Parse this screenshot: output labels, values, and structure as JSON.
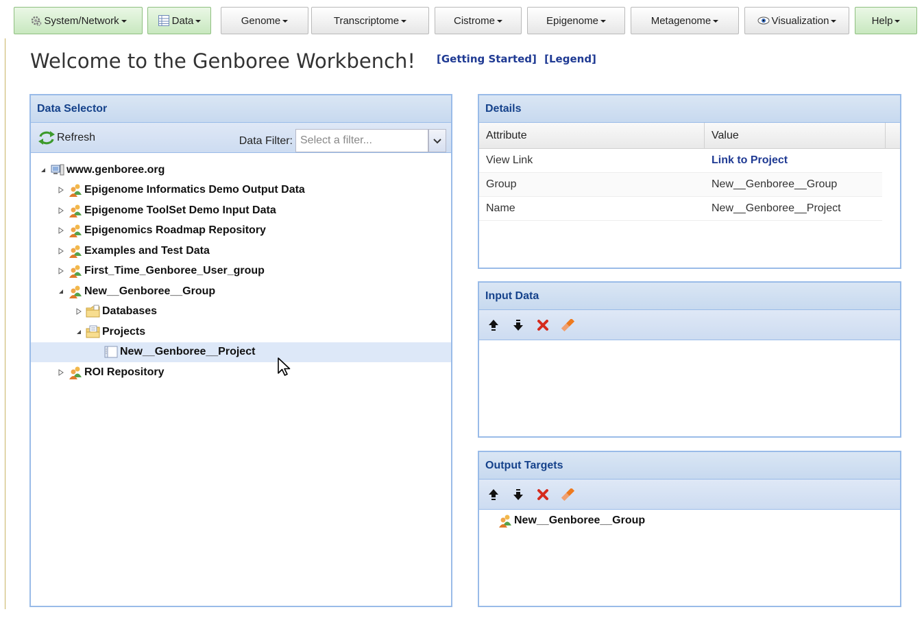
{
  "toolbar": {
    "system_network": "System/Network",
    "data": "Data",
    "genome": "Genome",
    "transcriptome": "Transcriptome",
    "cistrome": "Cistrome",
    "epigenome": "Epigenome",
    "metagenome": "Metagenome",
    "visualization": "Visualization",
    "help": "Help"
  },
  "header": {
    "title": "Welcome to the Genboree Workbench!",
    "getting_started": "[Getting Started]",
    "legend": "[Legend]"
  },
  "data_selector": {
    "title": "Data Selector",
    "refresh_label": "Refresh",
    "filter_label": "Data Filter:",
    "filter_placeholder": "Select a filter...",
    "tree": {
      "root": "www.genboree.org",
      "groups": [
        "Epigenome Informatics Demo Output Data",
        "Epigenome ToolSet Demo Input Data",
        "Epigenomics Roadmap Repository",
        "Examples and Test Data",
        "First_Time_Genboree_User_group",
        "New__Genboree__Group"
      ],
      "databases": "Databases",
      "projects": "Projects",
      "project": "New__Genboree__Project",
      "roi": "ROI Repository"
    }
  },
  "details": {
    "title": "Details",
    "col_attribute": "Attribute",
    "col_value": "Value",
    "rows": [
      {
        "attr": "View Link",
        "value": "Link to Project"
      },
      {
        "attr": "Group",
        "value": "New__Genboree__Group"
      },
      {
        "attr": "Name",
        "value": "New__Genboree__Project"
      }
    ]
  },
  "input_data": {
    "title": "Input Data"
  },
  "output_targets": {
    "title": "Output Targets",
    "items": [
      "New__Genboree__Group"
    ]
  },
  "colors": {
    "panel_border": "#99bbe8",
    "panel_title": "#15428b",
    "link": "#1f3a93",
    "remove_red": "#d52b1e"
  }
}
